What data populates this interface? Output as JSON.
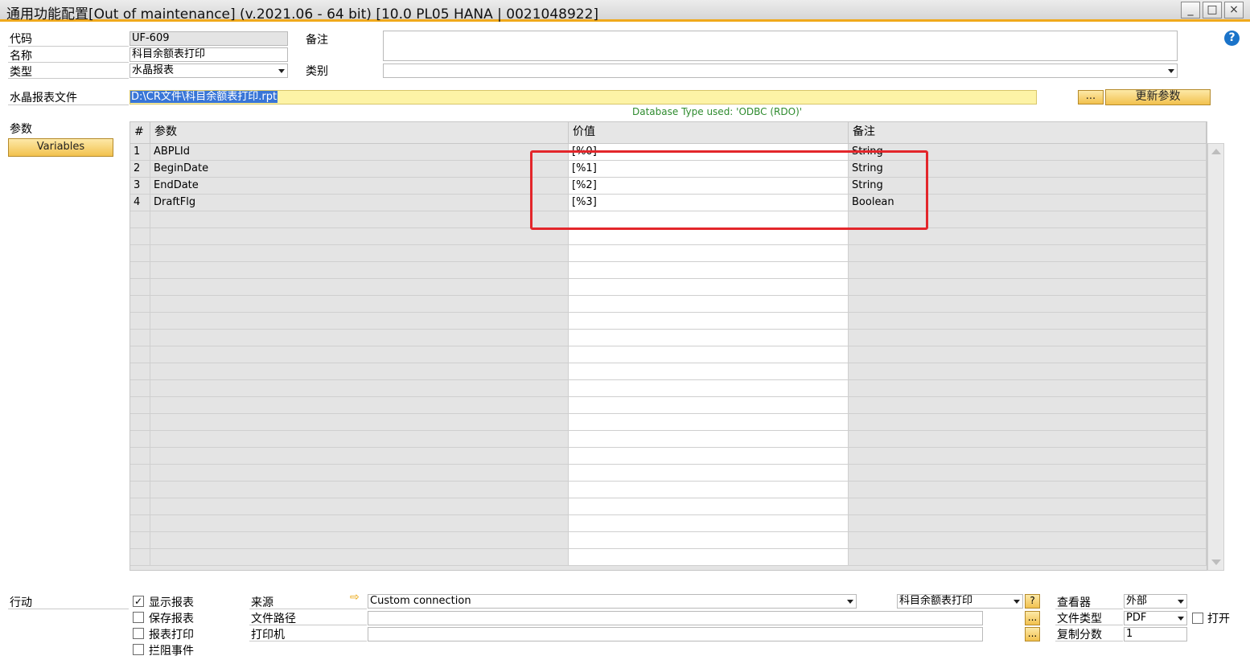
{
  "window": {
    "title": "通用功能配置[Out of maintenance]  (v.2021.06 - 64 bit) [10.0 PL05 HANA | 0021048922]",
    "minimize": "_",
    "maximize": "□",
    "close": "×"
  },
  "header": {
    "code_label": "代码",
    "code_value": "UF-609",
    "name_label": "名称",
    "name_value": "科目余额表打印",
    "type_label": "类型",
    "type_value": "水晶报表",
    "remark_label": "备注",
    "remark_value": "",
    "category_label": "类别",
    "category_value": "",
    "file_label": "水晶报表文件",
    "file_value": "D:\\CR文件\\科目余额表打印.rpt",
    "browse_label": "...",
    "update_params_label": "更新参数",
    "db_type_text": "Database Type used: 'ODBC (RDO)'"
  },
  "params": {
    "label": "参数",
    "variables_button": "Variables",
    "columns": [
      "#",
      "参数",
      "价值",
      "备注"
    ],
    "rows": [
      {
        "num": "1",
        "name": "ABPLId",
        "value": "[%0]",
        "remark": "String"
      },
      {
        "num": "2",
        "name": "BeginDate",
        "value": "[%1]",
        "remark": "String"
      },
      {
        "num": "3",
        "name": "EndDate",
        "value": "[%2]",
        "remark": "String"
      },
      {
        "num": "4",
        "name": "DraftFlg",
        "value": "[%3]",
        "remark": "Boolean"
      }
    ]
  },
  "action": {
    "label": "行动",
    "show_report": {
      "label": "显示报表",
      "checked": true
    },
    "save_report": {
      "label": "保存报表",
      "checked": false
    },
    "print_report": {
      "label": "报表打印",
      "checked": false
    },
    "intercept_event": {
      "label": "拦阻事件",
      "checked": false
    },
    "source_label": "来源",
    "source_value": "Custom connection",
    "filepath_label": "文件路径",
    "filepath_value": "",
    "printer_label": "打印机",
    "printer_value": "",
    "report_select_value": "科目余额表打印",
    "help_btn": "?",
    "browse_btn": "...",
    "viewer_label": "查看器",
    "viewer_value": "外部",
    "filetype_label": "文件类型",
    "filetype_value": "PDF",
    "open_label": "打开",
    "copies_label": "复制分数",
    "copies_value": "1"
  }
}
